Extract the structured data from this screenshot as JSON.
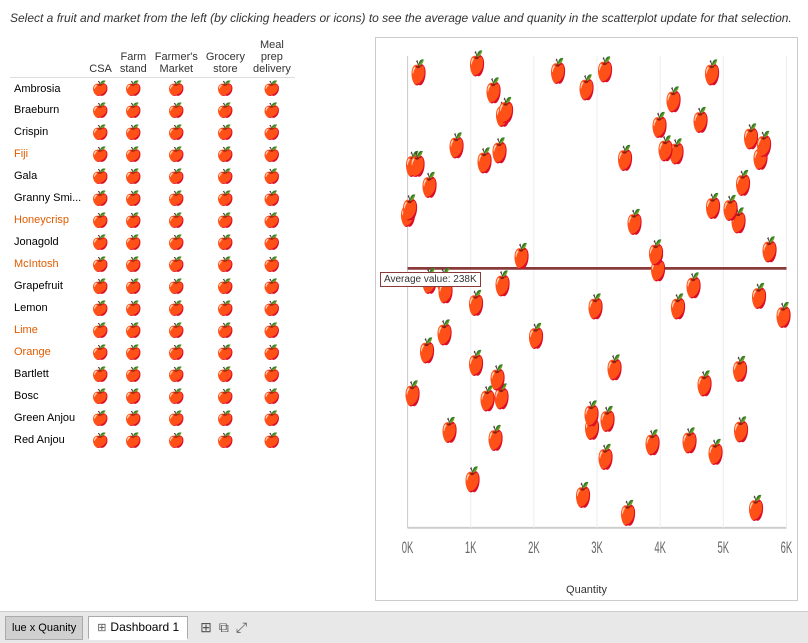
{
  "instruction": "Select a fruit and market from the left (by clicking  headers or icons) to see the average value and quanity in the scatterplot update for that selection.",
  "table": {
    "columns": [
      "",
      "CSA",
      "Farm stand",
      "Farmer's Market",
      "Grocery store",
      "Meal prep delivery"
    ],
    "fruits": [
      {
        "name": "Ambrosia",
        "highlighted": false
      },
      {
        "name": "Braeburn",
        "highlighted": false
      },
      {
        "name": "Crispin",
        "highlighted": false
      },
      {
        "name": "Fiji",
        "highlighted": true
      },
      {
        "name": "Gala",
        "highlighted": false
      },
      {
        "name": "Granny Smi...",
        "highlighted": false
      },
      {
        "name": "Honeycrisp",
        "highlighted": true
      },
      {
        "name": "Jonagold",
        "highlighted": false
      },
      {
        "name": "McIntosh",
        "highlighted": true
      },
      {
        "name": "Grapefruit",
        "highlighted": false
      },
      {
        "name": "Lemon",
        "highlighted": false
      },
      {
        "name": "Lime",
        "highlighted": true
      },
      {
        "name": "Orange",
        "highlighted": true
      },
      {
        "name": "Bartlett",
        "highlighted": false
      },
      {
        "name": "Bosc",
        "highlighted": false
      },
      {
        "name": "Green Anjou",
        "highlighted": false
      },
      {
        "name": "Red Anjou",
        "highlighted": false
      }
    ]
  },
  "scatterplot": {
    "avg_label": "Average value: 238K",
    "x_axis_label": "Quantity",
    "x_ticks": [
      "0K",
      "1K",
      "2K",
      "3K",
      "4K",
      "5K",
      "6K"
    ],
    "avg_line_y_pct": 45
  },
  "tabs": [
    {
      "label": "Dashboard 1",
      "active": true,
      "icon": "⊞"
    }
  ],
  "partial_tab_label": "lue x Quanity",
  "tab_actions": [
    {
      "icon": "⊞",
      "name": "add-dashboard"
    },
    {
      "icon": "⧉",
      "name": "duplicate-dashboard"
    },
    {
      "icon": "↕",
      "name": "move-dashboard"
    }
  ]
}
